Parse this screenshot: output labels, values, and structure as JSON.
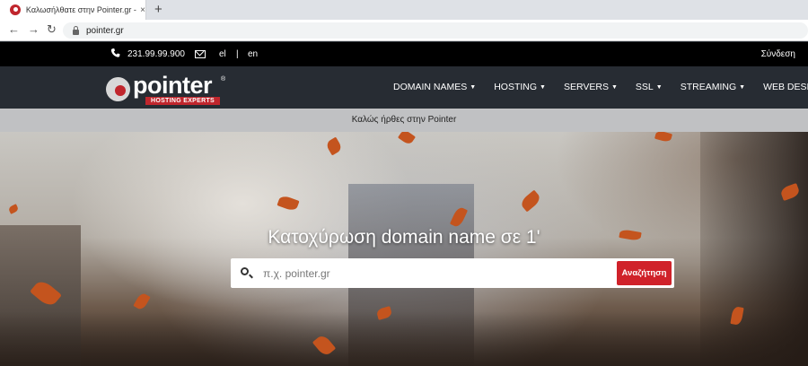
{
  "browser": {
    "tab_title": "Καλωσήλθατε στην Pointer.gr - Η",
    "tab_close": "×",
    "new_tab": "+",
    "back": "←",
    "forward": "→",
    "reload": "↻",
    "url": "pointer.gr"
  },
  "topbar": {
    "phone": "231.99.99.900",
    "lang_el": "el",
    "lang_separator": "|",
    "lang_en": "en",
    "login": "Σύνδεση"
  },
  "header": {
    "logo_text": "pointer",
    "logo_tagline": "HOSTING EXPERTS",
    "logo_registered": "®",
    "menu": [
      {
        "label": "DOMAIN NAMES"
      },
      {
        "label": "HOSTING"
      },
      {
        "label": "SERVERS"
      },
      {
        "label": "SSL"
      },
      {
        "label": "STREAMING"
      },
      {
        "label": "WEB DESIGN"
      }
    ],
    "caret": "▼"
  },
  "welcome": "Καλώς ήρθες στην Pointer",
  "hero": {
    "title": "Κατοχύρωση domain name σε 1'",
    "search_placeholder": "π.χ. pointer.gr",
    "search_button": "Αναζήτηση"
  },
  "colors": {
    "brand_red": "#d0222a",
    "header_bg": "#272c33",
    "topbar_bg": "#000000"
  }
}
